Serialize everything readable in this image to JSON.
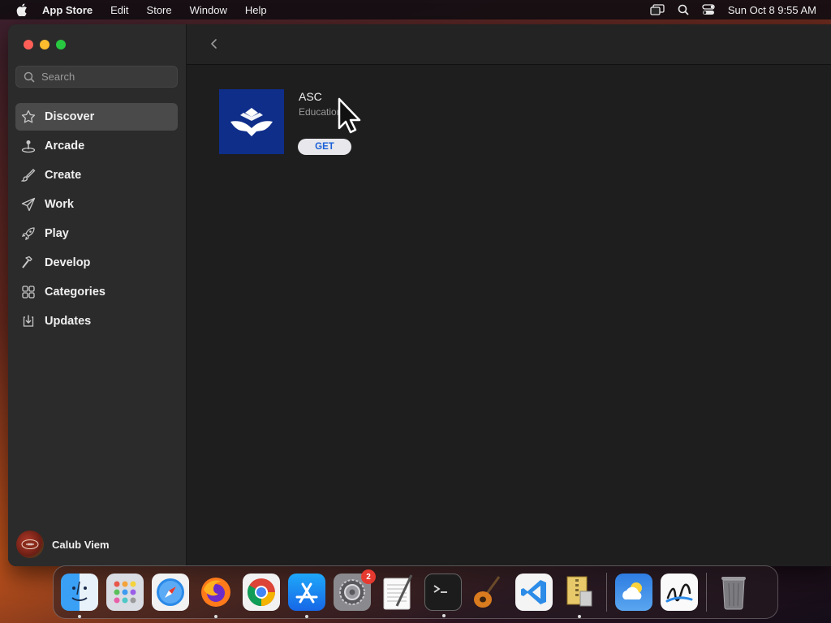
{
  "menubar": {
    "app_name": "App Store",
    "items": [
      "Edit",
      "Store",
      "Window",
      "Help"
    ],
    "clock": "Sun Oct 8  9:55 AM"
  },
  "window": {
    "search_placeholder": "Search",
    "sidebar": {
      "items": [
        {
          "label": "Discover",
          "icon": "star-icon",
          "active": true
        },
        {
          "label": "Arcade",
          "icon": "joystick-icon",
          "active": false
        },
        {
          "label": "Create",
          "icon": "paintbrush-icon",
          "active": false
        },
        {
          "label": "Work",
          "icon": "paper-plane-icon",
          "active": false
        },
        {
          "label": "Play",
          "icon": "rocket-icon",
          "active": false
        },
        {
          "label": "Develop",
          "icon": "hammer-icon",
          "active": false
        },
        {
          "label": "Categories",
          "icon": "grid-icon",
          "active": false
        },
        {
          "label": "Updates",
          "icon": "download-icon",
          "active": false
        }
      ],
      "user_name": "Calub Viem"
    },
    "app": {
      "title": "ASC",
      "category": "Education",
      "get_label": "GET",
      "icon_color": "#0f2e8a"
    }
  },
  "dock": {
    "items": [
      {
        "name": "finder",
        "running": true
      },
      {
        "name": "launchpad",
        "running": false
      },
      {
        "name": "safari",
        "running": false
      },
      {
        "name": "firefox",
        "running": true
      },
      {
        "name": "chrome",
        "running": false
      },
      {
        "name": "app-store",
        "running": true
      },
      {
        "name": "system-settings",
        "running": false,
        "badge": "2"
      },
      {
        "name": "textedit",
        "running": false
      },
      {
        "name": "terminal",
        "running": true
      },
      {
        "name": "garageband",
        "running": false
      },
      {
        "name": "vscode",
        "running": false
      },
      {
        "name": "archive-utility",
        "running": true
      },
      {
        "name": "weather",
        "running": false
      },
      {
        "name": "freeform",
        "running": false
      },
      {
        "name": "trash",
        "running": false
      }
    ]
  }
}
